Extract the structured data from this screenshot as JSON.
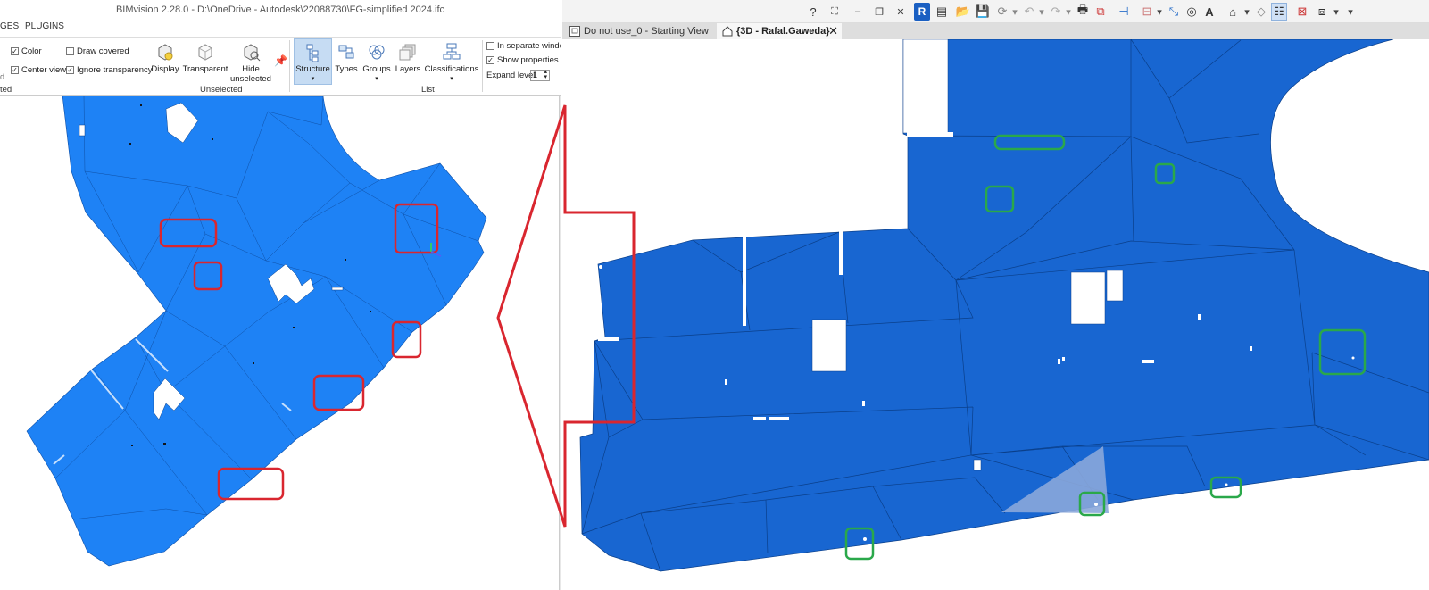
{
  "left_app": {
    "title": "BIMvision 2.28.0 - D:\\OneDrive - Autodesk\\22088730\\FG-simplified 2024.ifc",
    "menu": [
      "GES",
      "PLUGINS"
    ],
    "checkboxes": {
      "color": {
        "label": "Color",
        "checked": true
      },
      "draw_covered": {
        "label": "Draw covered",
        "checked": false
      },
      "center_view": {
        "label": "Center view",
        "checked": true
      },
      "ignore_transparency": {
        "label": "Ignore transparency",
        "checked": true
      },
      "in_separate_window": {
        "label": "In separate window",
        "checked": false
      },
      "show_properties": {
        "label": "Show properties",
        "checked": true
      }
    },
    "left_clip_labels": [
      "d",
      "ted"
    ],
    "ribbon_buttons": {
      "display": "Display",
      "transparent": "Transparent",
      "hide_unselected_1": "Hide",
      "hide_unselected_2": "unselected",
      "structure": "Structure",
      "types": "Types",
      "groups": "Groups",
      "layers": "Layers",
      "classifications": "Classifications"
    },
    "group_labels": {
      "unselected": "Unselected",
      "list": "List"
    },
    "expand_level": {
      "label": "Expand level",
      "value": "1"
    },
    "active_button": "Structure"
  },
  "right_app": {
    "quick_access": {
      "help": "?",
      "close": "✕",
      "minimize": "–",
      "restore": "❐"
    },
    "tabs": [
      {
        "label": "Do not use_0 - Starting View",
        "active": false
      },
      {
        "label": "{3D - Rafal.Gaweda}",
        "active": true
      }
    ],
    "tab_close": "✕"
  },
  "colors": {
    "model_blue": "#1e82f5",
    "revit_blue": "#1866d1",
    "red_marker": "#d9262f",
    "green_marker": "#2aa84a",
    "ribbon_active": "#c6dcf3"
  }
}
